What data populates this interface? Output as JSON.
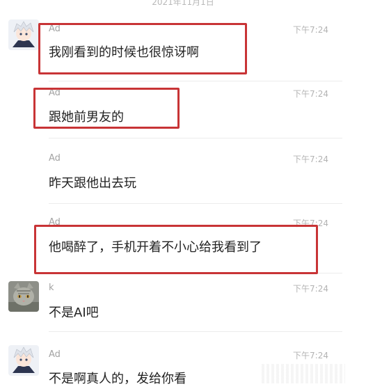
{
  "date": "2021年11月1日",
  "colors": {
    "highlight": "#c83436",
    "text": "#222222",
    "meta": "#a3a3a3"
  },
  "messages": [
    {
      "sender": "Ad",
      "time": "下午7:24",
      "text": "我刚看到的时候也很惊讶啊",
      "avatar": "anime-boy-avatar"
    },
    {
      "sender": "Ad",
      "time": "下午7:24",
      "text": "跟她前男友的"
    },
    {
      "sender": "Ad",
      "time": "下午7:24",
      "text": "昨天跟他出去玩"
    },
    {
      "sender": "Ad",
      "time": "下午7:24",
      "text": "他喝醉了，手机开着不小心给我看到了"
    },
    {
      "sender": "k",
      "time": "下午7:24",
      "text": "不是AI吧",
      "avatar": "cat-avatar"
    },
    {
      "sender": "Ad",
      "time": "下午7:24",
      "text": "不是啊真人的，发给你看",
      "avatar": "anime-boy-avatar"
    }
  ]
}
